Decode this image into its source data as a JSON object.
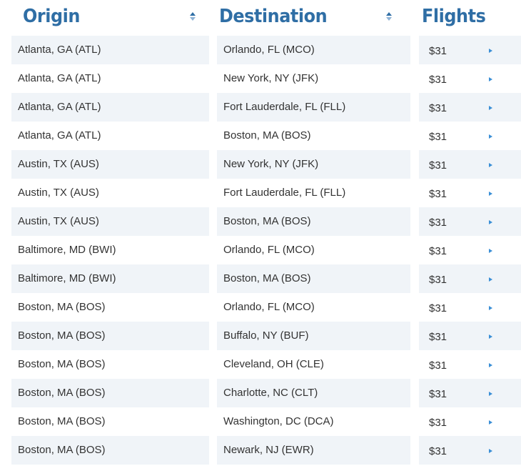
{
  "header": {
    "origin_label": "Origin",
    "destination_label": "Destination",
    "flights_label": "Flights"
  },
  "colors": {
    "header_text": "#2f6ea5",
    "row_shade": "#f0f4f8",
    "arrow": "#3b8fd6"
  },
  "rows": [
    {
      "origin": "Atlanta, GA (ATL)",
      "destination": "Orlando, FL (MCO)",
      "price": "$31"
    },
    {
      "origin": "Atlanta, GA (ATL)",
      "destination": "New York, NY (JFK)",
      "price": "$31"
    },
    {
      "origin": "Atlanta, GA (ATL)",
      "destination": "Fort Lauderdale, FL (FLL)",
      "price": "$31"
    },
    {
      "origin": "Atlanta, GA (ATL)",
      "destination": "Boston, MA (BOS)",
      "price": "$31"
    },
    {
      "origin": "Austin, TX (AUS)",
      "destination": "New York, NY (JFK)",
      "price": "$31"
    },
    {
      "origin": "Austin, TX (AUS)",
      "destination": "Fort Lauderdale, FL (FLL)",
      "price": "$31"
    },
    {
      "origin": "Austin, TX (AUS)",
      "destination": "Boston, MA (BOS)",
      "price": "$31"
    },
    {
      "origin": "Baltimore, MD (BWI)",
      "destination": "Orlando, FL (MCO)",
      "price": "$31"
    },
    {
      "origin": "Baltimore, MD (BWI)",
      "destination": "Boston, MA (BOS)",
      "price": "$31"
    },
    {
      "origin": "Boston, MA (BOS)",
      "destination": "Orlando, FL (MCO)",
      "price": "$31"
    },
    {
      "origin": "Boston, MA (BOS)",
      "destination": "Buffalo, NY (BUF)",
      "price": "$31"
    },
    {
      "origin": "Boston, MA (BOS)",
      "destination": "Cleveland, OH (CLE)",
      "price": "$31"
    },
    {
      "origin": "Boston, MA (BOS)",
      "destination": "Charlotte, NC (CLT)",
      "price": "$31"
    },
    {
      "origin": "Boston, MA (BOS)",
      "destination": "Washington, DC (DCA)",
      "price": "$31"
    },
    {
      "origin": "Boston, MA (BOS)",
      "destination": "Newark, NJ (EWR)",
      "price": "$31"
    }
  ]
}
